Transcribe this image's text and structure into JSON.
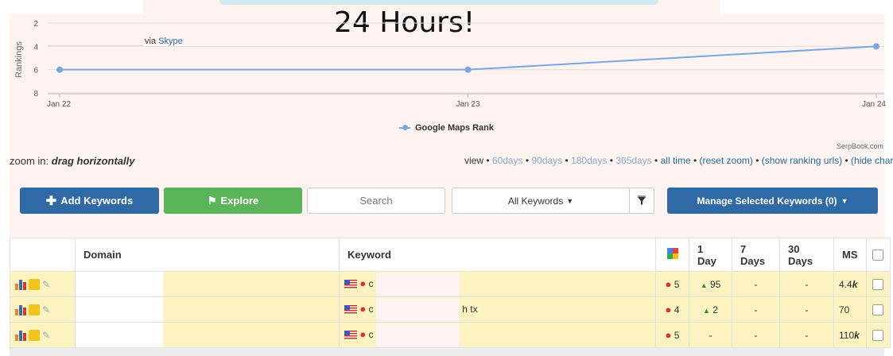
{
  "banner": {
    "headline": "24 Hours!",
    "via_text": "via",
    "via_link": "Skype"
  },
  "chart_data": {
    "type": "line",
    "title": "",
    "ylabel": "Rankings",
    "xlabel": "",
    "y_axis_reversed": true,
    "ylim": [
      8,
      2
    ],
    "yticks": [
      "2",
      "4",
      "6",
      "8"
    ],
    "x": [
      "Jan 22",
      "Jan 23",
      "Jan 24"
    ],
    "series": [
      {
        "name": "Google Maps Rank",
        "values": [
          6,
          6,
          4
        ],
        "color": "#7aa8dc"
      }
    ],
    "legend": "bottom-center",
    "credit": "SerpBook.com"
  },
  "zoom": {
    "prefix": "zoom in:",
    "hint": "drag horizontally"
  },
  "viewbar": {
    "label": "view •",
    "items": [
      {
        "text": "60days",
        "muted": true
      },
      {
        "text": "90days",
        "muted": true
      },
      {
        "text": "180days",
        "muted": true
      },
      {
        "text": "365days",
        "muted": true
      },
      {
        "text": "all time",
        "muted": false
      },
      {
        "text": "(reset zoom)",
        "muted": false
      },
      {
        "text": "(show ranking urls)",
        "muted": false
      },
      {
        "text": "(hide chart)",
        "muted": false
      }
    ]
  },
  "toolbar": {
    "add_label": "Add Keywords",
    "explore_label": "Explore",
    "search_placeholder": "Search",
    "filter_selected": "All Keywords",
    "manage_label": "Manage Selected Keywords (0)"
  },
  "table": {
    "headers": {
      "domain": "Domain",
      "keyword": "Keyword",
      "day1": "1 Day",
      "day7": "7 Days",
      "day30": "30 Days",
      "ms": "MS"
    },
    "rows": [
      {
        "keyword_prefix": "c",
        "keyword_suffix": "",
        "rank": "5",
        "change_1": "95",
        "change_1_up": true,
        "change_7": "-",
        "change_30": "-",
        "ms": "4.4",
        "ms_unit": "k"
      },
      {
        "keyword_prefix": "c",
        "keyword_suffix": "h tx",
        "rank": "4",
        "change_1": "2",
        "change_1_up": true,
        "change_7": "-",
        "change_30": "-",
        "ms": "70",
        "ms_unit": ""
      },
      {
        "keyword_prefix": "c",
        "keyword_suffix": "",
        "rank": "5",
        "change_1": "-",
        "change_1_up": false,
        "change_7": "-",
        "change_30": "-",
        "ms": "110",
        "ms_unit": "k"
      }
    ]
  }
}
